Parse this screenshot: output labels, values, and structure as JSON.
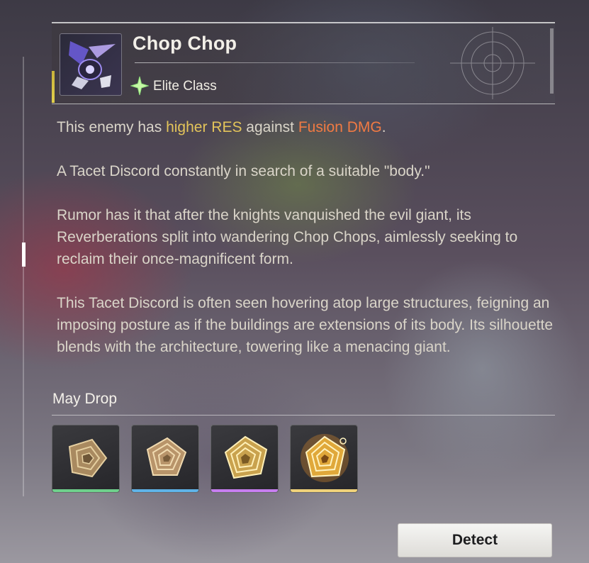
{
  "enemy": {
    "name": "Chop Chop",
    "class_label": "Elite Class",
    "class_icon": "elite-star-icon",
    "portrait_icon": "chop-chop-portrait"
  },
  "description": {
    "line1_prefix": "This enemy has ",
    "line1_highlight_res": "higher RES",
    "line1_mid": " against ",
    "line1_highlight_dmg": "Fusion DMG",
    "line1_suffix": ".",
    "para2": "A Tacet Discord constantly in search of a suitable \"body.\"",
    "para3": "Rumor has it that after the knights vanquished the evil giant, its Reverberations split into wandering Chop Chops, aimlessly seeking to reclaim their once-magnificent form.",
    "para4": "This Tacet Discord is often seen hovering atop large structures, feigning an imposing posture as if the buildings are extensions of its body. Its silhouette blends with the architecture, towering like a menacing giant."
  },
  "drops": {
    "title": "May Drop",
    "items": [
      {
        "icon": "waveworn-residue-icon",
        "rarity_color": "#6fd08c"
      },
      {
        "icon": "waveworn-residue-icon",
        "rarity_color": "#5fb3e8"
      },
      {
        "icon": "waveworn-residue-icon",
        "rarity_color": "#c77ef0"
      },
      {
        "icon": "waveworn-residue-icon",
        "rarity_color": "#f0d27a"
      }
    ]
  },
  "actions": {
    "detect_label": "Detect"
  },
  "colors": {
    "highlight_res": "#e3c45a",
    "highlight_dmg": "#f07a43"
  }
}
